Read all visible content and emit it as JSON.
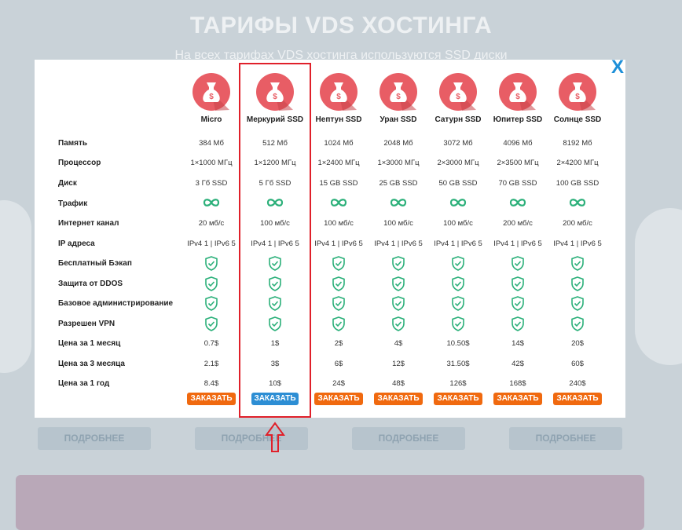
{
  "background": {
    "title": "ТАРИФЫ VDS ХОСТИНГА",
    "subtitle": "На всех тарифах VDS хостинга используются SSD диски",
    "more_buttons": [
      "ПОДРОБНЕЕ",
      "ПОДРОБНЕЕ",
      "ПОДРОБНЕЕ",
      "ПОДРОБНЕЕ"
    ]
  },
  "modal": {
    "close_label": "X",
    "row_labels": [
      "Память",
      "Процессор",
      "Диск",
      "Трафик",
      "Интернет канал",
      "IP адреса",
      "Бесплатный Бэкап",
      "Защита от DDOS",
      "Базовое администрирование",
      "Разрешен VPN",
      "Цена за 1 месяц",
      "Цена за 3 месяца",
      "Цена за 1 год"
    ],
    "plans": [
      {
        "name": "Micro",
        "memory": "384 Мб",
        "cpu": "1×1000 МГц",
        "disk": "3 Гб SSD",
        "channel": "20 мб/с",
        "ip": "IPv4 1 | IPv6 5",
        "price_1m": "0.7$",
        "price_3m": "2.1$",
        "price_1y": "8.4$",
        "order_label": "ЗАКАЗАТЬ"
      },
      {
        "name": "Меркурий SSD",
        "memory": "512 Мб",
        "cpu": "1×1200 МГц",
        "disk": "5 Гб SSD",
        "channel": "100 мб/с",
        "ip": "IPv4 1 | IPv6 5",
        "price_1m": "1$",
        "price_3m": "3$",
        "price_1y": "10$",
        "order_label": "ЗАКАЗАТЬ"
      },
      {
        "name": "Нептун SSD",
        "memory": "1024 Мб",
        "cpu": "1×2400 МГц",
        "disk": "15 GB SSD",
        "channel": "100 мб/с",
        "ip": "IPv4 1 | IPv6 5",
        "price_1m": "2$",
        "price_3m": "6$",
        "price_1y": "24$",
        "order_label": "ЗАКАЗАТЬ"
      },
      {
        "name": "Уран SSD",
        "memory": "2048 Мб",
        "cpu": "1×3000 МГц",
        "disk": "25 GB SSD",
        "channel": "100 мб/с",
        "ip": "IPv4 1 | IPv6 5",
        "price_1m": "4$",
        "price_3m": "12$",
        "price_1y": "48$",
        "order_label": "ЗАКАЗАТЬ"
      },
      {
        "name": "Сатурн SSD",
        "memory": "3072 Мб",
        "cpu": "2×3000 МГц",
        "disk": "50 GB SSD",
        "channel": "100 мб/с",
        "ip": "IPv4 1 | IPv6 5",
        "price_1m": "10.50$",
        "price_3m": "31.50$",
        "price_1y": "126$",
        "order_label": "ЗАКАЗАТЬ"
      },
      {
        "name": "Юпитер SSD",
        "memory": "4096 Мб",
        "cpu": "2×3500 МГц",
        "disk": "70 GB SSD",
        "channel": "200 мб/с",
        "ip": "IPv4 1 | IPv6 5",
        "price_1m": "14$",
        "price_3m": "42$",
        "price_1y": "168$",
        "order_label": "ЗАКАЗАТЬ"
      },
      {
        "name": "Солнце SSD",
        "memory": "8192 Мб",
        "cpu": "2×4200 МГц",
        "disk": "100 GB SSD",
        "channel": "200 мб/с",
        "ip": "IPv4 1 | IPv6 5",
        "price_1m": "20$",
        "price_3m": "60$",
        "price_1y": "240$",
        "order_label": "ЗАКАЗАТЬ"
      }
    ],
    "selected_plan": "Меркурий SSD"
  },
  "colors": {
    "order_button": "#f0690f",
    "order_button_selected": "#2d8ed4",
    "icon_circle": "#e85d65",
    "check_green": "#2cb07a",
    "highlight_red": "#e0202a",
    "close_blue": "#1d8fd8"
  },
  "icons": {
    "plan_icon": "money-bag-icon",
    "traffic_icon": "infinity-icon",
    "feature_icon": "shield-check-icon",
    "annotation": "arrow-up-icon"
  }
}
